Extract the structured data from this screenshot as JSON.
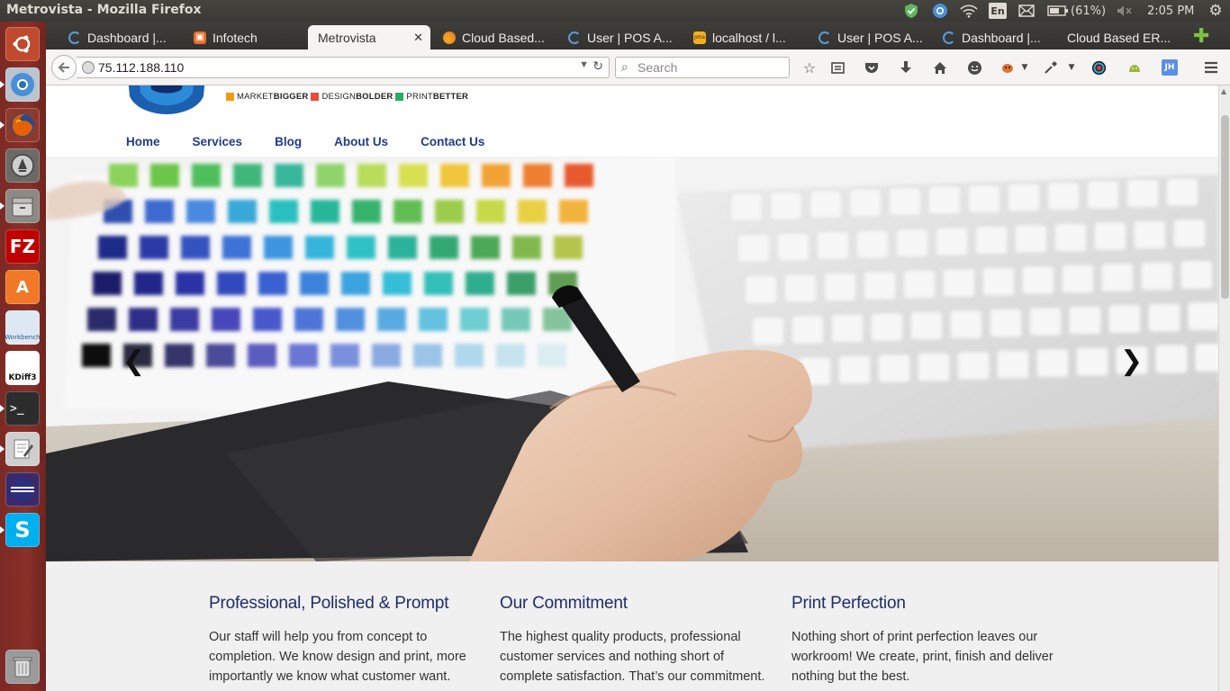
{
  "system": {
    "window_title": "Metrovista - Mozilla Firefox",
    "keyboard_layout": "En",
    "battery": "(61%)",
    "clock": "2:05 PM"
  },
  "launcher": {
    "items": [
      {
        "name": "ubuntu-dash",
        "icon": "ubuntu-logo-icon",
        "color": "#e95420"
      },
      {
        "name": "chromium",
        "icon": "chromium-icon",
        "color": "#4a90d9"
      },
      {
        "name": "firefox",
        "icon": "firefox-icon",
        "color": "#e66000"
      },
      {
        "name": "software-updater",
        "icon": "updater-icon",
        "color": "#555555"
      },
      {
        "name": "files",
        "icon": "file-cabinet-icon",
        "color": "#8c8a85"
      },
      {
        "name": "filezilla",
        "icon": "filezilla-icon",
        "color": "#bf0000",
        "label": "FZ"
      },
      {
        "name": "software-center",
        "icon": "shopping-bag-icon",
        "color": "#f07826",
        "label": "A"
      },
      {
        "name": "mysql-workbench",
        "icon": "workbench-icon",
        "color": "#dde8f2",
        "label": "Workbench"
      },
      {
        "name": "kdiff3",
        "icon": "kdiff3-icon",
        "color": "#ffffff",
        "label": "KDiff3"
      },
      {
        "name": "terminal",
        "icon": "terminal-icon",
        "color": "#2c2c2c",
        "label": ">_"
      },
      {
        "name": "text-editor",
        "icon": "text-editor-icon",
        "color": "#cfcfcf"
      },
      {
        "name": "eclipse",
        "icon": "eclipse-icon",
        "color": "#2c2f7f"
      },
      {
        "name": "skype",
        "icon": "skype-icon",
        "color": "#00aff0",
        "label": "S"
      },
      {
        "name": "trash",
        "icon": "trash-icon",
        "color": "#9a9a9a"
      }
    ]
  },
  "tabs": [
    {
      "label": "Dashboard |...",
      "icon": "loading-spinner-icon",
      "color": "#5b9bd5"
    },
    {
      "label": "Infotech",
      "icon": "infotech-favicon-icon",
      "color": "#e8702a"
    },
    {
      "label": "Metrovista",
      "active": true
    },
    {
      "label": "Cloud Based...",
      "icon": "flame-favicon-icon",
      "color": "#e8702a"
    },
    {
      "label": "User | POS A...",
      "icon": "loading-spinner-icon",
      "color": "#5b9bd5"
    },
    {
      "label": "localhost / l...",
      "icon": "phpmyadmin-icon",
      "color": "#f2b01e"
    },
    {
      "label": "User | POS A...",
      "icon": "loading-spinner-icon",
      "color": "#5b9bd5"
    },
    {
      "label": "Dashboard |...",
      "icon": "loading-spinner-icon",
      "color": "#5b9bd5"
    },
    {
      "label": "Cloud Based ER..."
    }
  ],
  "navbar": {
    "url": "75.112.188.110",
    "search_placeholder": "Search"
  },
  "site": {
    "tagline": {
      "part1_a": "MARKET",
      "part1_b": "BIGGER",
      "part2_a": "DESIGN",
      "part2_b": "BOLDER",
      "part3_a": "PRINT",
      "part3_b": "BETTER",
      "colors": [
        "#f39c12",
        "#e74c3c",
        "#27ae60"
      ]
    },
    "nav": [
      "Home",
      "Services",
      "Blog",
      "About Us",
      "Contact Us"
    ],
    "hero": {
      "prev_glyph": "❮",
      "next_glyph": "❯"
    },
    "features": [
      {
        "title": "Professional, Polished & Prompt",
        "body": "Our staff will help you from concept to completion. We know design and print, more importantly we know what customer want."
      },
      {
        "title": "Our Commitment",
        "body": "The highest quality products, professional customer services and nothing short of complete satisfaction. That’s our commitment."
      },
      {
        "title": "Print Perfection",
        "body": "Nothing short of print perfection leaves our workroom! We create, print, finish and deliver nothing but the best."
      }
    ]
  }
}
